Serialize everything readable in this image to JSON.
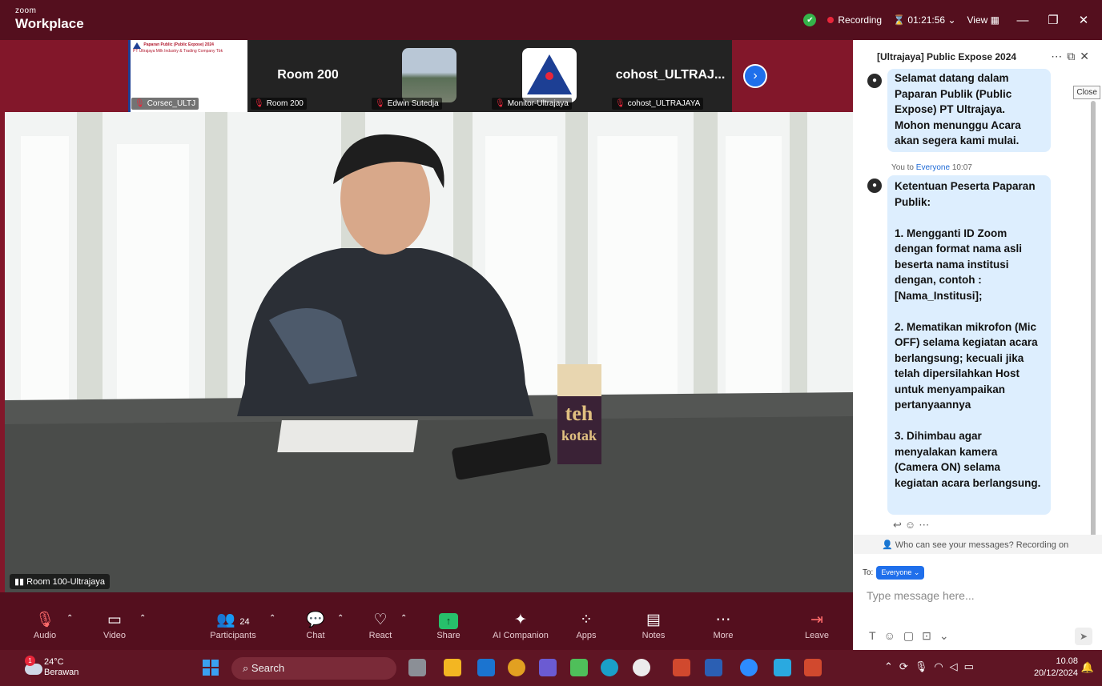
{
  "titlebar": {
    "brand_small": "zoom",
    "brand_big": "Workplace",
    "recording": "Recording",
    "timer": "01:21:56",
    "view": "View"
  },
  "strip": {
    "tiles": [
      {
        "label": "Corsec_ULTJ",
        "slide_title": "Paparan Public (Public Expose) 2024",
        "slide_sub": "PT Ultrajaya Milk Industry & Trading Company Tbk"
      },
      {
        "label": "Room 200",
        "big": "Room 200"
      },
      {
        "label": "Edwin Sutedja"
      },
      {
        "label": "Monitor-Ultrajaya"
      },
      {
        "label": "cohost_ULTRAJAYA",
        "big": "cohost_ULTRAJ..."
      }
    ]
  },
  "video": {
    "label": "Room 100-Ultrajaya",
    "carton_text": "teh kotak"
  },
  "toolbar": {
    "audio": "Audio",
    "video": "Video",
    "participants": "Participants",
    "participants_count": "24",
    "chat": "Chat",
    "react": "React",
    "share": "Share",
    "ai": "AI Companion",
    "apps": "Apps",
    "notes": "Notes",
    "more": "More",
    "leave": "Leave"
  },
  "chat": {
    "title": "[Ultrajaya] Public Expose 2024",
    "close_tip": "Close",
    "msg1": "Selamat datang dalam Paparan Publik (Public Expose) PT Ultrajaya. Mohon menunggu Acara akan segera kami mulai.",
    "meta_from": "You to",
    "meta_to": "Everyone",
    "meta_time": "10:07",
    "msg2": "Ketentuan Peserta Paparan Publik:\n\n1. Mengganti ID Zoom dengan format nama asli beserta nama institusi dengan, contoh : [Nama_Institusi];\n\n2. Mematikan mikrofon (Mic OFF) selama kegiatan acara berlangsung; kecuali jika telah dipersilahkan Host untuk menyampaikan pertanyaannya\n\n3. Dihimbau agar menyalakan kamera (Camera ON) selama kegiatan acara berlangsung.",
    "who_can_see": "Who can see your messages? Recording on",
    "to_label": "To:",
    "to_value": "Everyone",
    "placeholder": "Type message here..."
  },
  "taskbar": {
    "temp": "24°C",
    "weather": "Berawan",
    "notif_count": "1",
    "search": "Search",
    "time": "10.08",
    "date": "20/12/2024"
  },
  "colors": {
    "zoom_maroon": "#540f1e",
    "accent_blue": "#1f6feb",
    "bubble": "#ddeefe"
  }
}
